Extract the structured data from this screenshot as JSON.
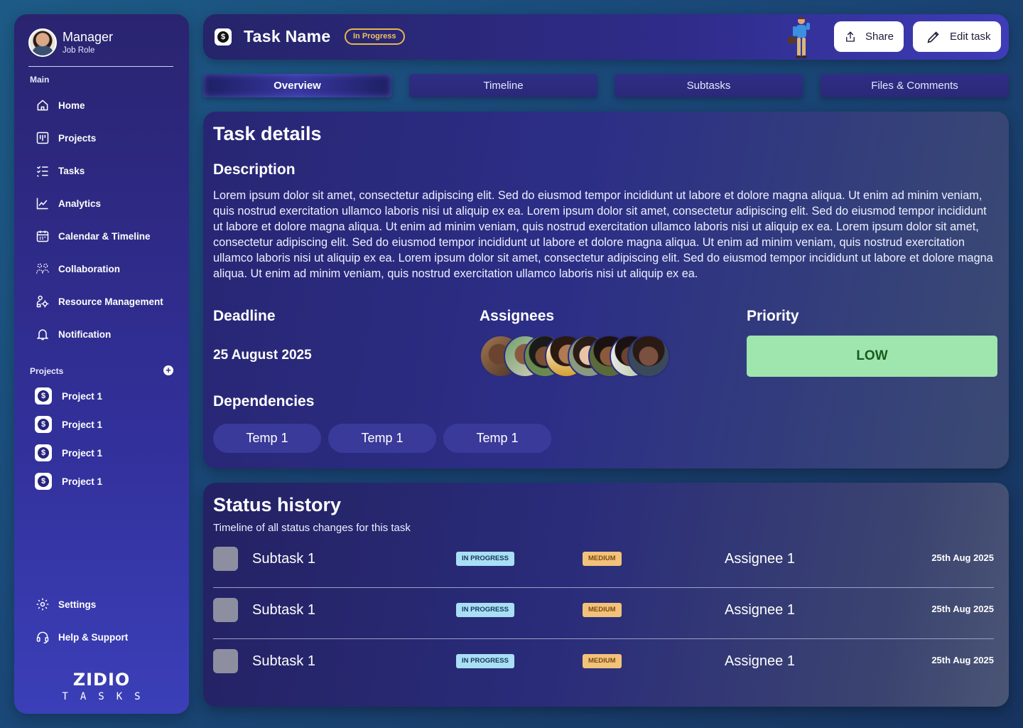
{
  "sidebar": {
    "profile": {
      "name": "Manager",
      "role": "Job Role"
    },
    "main_label": "Main",
    "nav": [
      {
        "label": "Home",
        "icon": "home-icon"
      },
      {
        "label": "Projects",
        "icon": "kanban-icon"
      },
      {
        "label": "Tasks",
        "icon": "checklist-icon"
      },
      {
        "label": "Analytics",
        "icon": "chart-line-icon"
      },
      {
        "label": "Calendar & Timeline",
        "icon": "calendar-icon"
      },
      {
        "label": "Collaboration",
        "icon": "people-icon"
      },
      {
        "label": "Resource Management",
        "icon": "resource-icon"
      },
      {
        "label": "Notification",
        "icon": "bell-icon"
      }
    ],
    "projects_label": "Projects",
    "projects": [
      {
        "label": "Project 1"
      },
      {
        "label": "Project 1"
      },
      {
        "label": "Project 1"
      },
      {
        "label": "Project 1"
      }
    ],
    "bottom": [
      {
        "label": "Settings",
        "icon": "gear-icon"
      },
      {
        "label": "Help & Support",
        "icon": "headset-icon"
      }
    ],
    "brand": {
      "main": "ZIDIO",
      "sub": "TASKS"
    }
  },
  "header": {
    "title": "Task Name",
    "status": "In Progress",
    "share_label": "Share",
    "edit_label": "Edit task"
  },
  "tabs": [
    {
      "label": "Overview",
      "active": true
    },
    {
      "label": "Timeline",
      "active": false
    },
    {
      "label": "Subtasks",
      "active": false
    },
    {
      "label": "Files & Comments",
      "active": false
    }
  ],
  "details": {
    "title": "Task details",
    "description_label": "Description",
    "description": "Lorem ipsum dolor sit amet, consectetur adipiscing elit. Sed do eiusmod tempor incididunt ut labore et dolore magna aliqua. Ut enim ad minim veniam, quis nostrud exercitation ullamco laboris nisi ut aliquip ex ea. Lorem ipsum dolor sit amet, consectetur adipiscing elit. Sed do eiusmod tempor incididunt ut labore et dolore magna aliqua. Ut enim ad minim veniam, quis nostrud exercitation ullamco laboris nisi ut aliquip ex ea. Lorem ipsum dolor sit amet, consectetur adipiscing elit. Sed do eiusmod tempor incididunt ut labore et dolore magna aliqua. Ut enim ad minim veniam, quis nostrud exercitation ullamco laboris nisi ut aliquip ex ea. Lorem ipsum dolor sit amet, consectetur adipiscing elit. Sed do eiusmod tempor incididunt ut labore et dolore magna aliqua. Ut enim ad minim veniam, quis nostrud exercitation ullamco laboris nisi ut aliquip ex ea.",
    "deadline_label": "Deadline",
    "deadline": "25 August 2025",
    "assignees_label": "Assignees",
    "priority_label": "Priority",
    "priority": "LOW",
    "priority_color": "#9ee6ad",
    "dependencies_label": "Dependencies",
    "dependencies": [
      "Temp 1",
      "Temp 1",
      "Temp 1"
    ]
  },
  "history": {
    "title": "Status history",
    "subtitle": "Timeline of all status changes for this task",
    "rows": [
      {
        "name": "Subtask 1",
        "status": "IN PROGRESS",
        "priority": "MEDIUM",
        "assignee": "Assignee 1",
        "date": "25th Aug 2025"
      },
      {
        "name": "Subtask 1",
        "status": "IN PROGRESS",
        "priority": "MEDIUM",
        "assignee": "Assignee 1",
        "date": "25th Aug 2025"
      },
      {
        "name": "Subtask 1",
        "status": "IN PROGRESS",
        "priority": "MEDIUM",
        "assignee": "Assignee 1",
        "date": "25th Aug 2025"
      }
    ]
  },
  "colors": {
    "accent": "#2f2c8a",
    "status_in_progress": "#f0c25a",
    "badge_progress": "#a9dff5",
    "badge_medium": "#f2c27a"
  }
}
